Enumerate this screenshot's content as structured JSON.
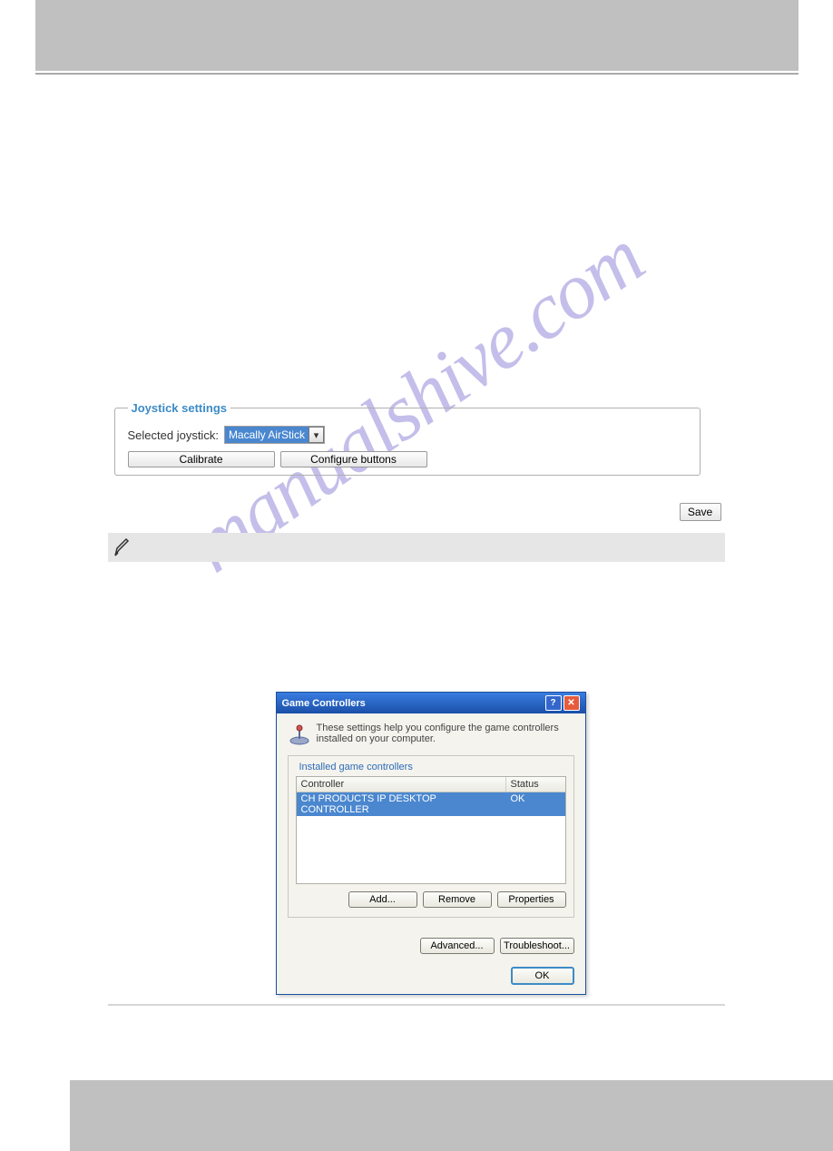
{
  "joystick_settings": {
    "legend": "Joystick settings",
    "selected_label": "Selected joystick:",
    "selected_value": "Macally AirStick",
    "calibrate": "Calibrate",
    "configure": "Configure buttons",
    "save": "Save"
  },
  "game_controllers": {
    "title": "Game Controllers",
    "description": "These settings help you configure the game controllers installed on your computer.",
    "group_title": "Installed game controllers",
    "columns": {
      "controller": "Controller",
      "status": "Status"
    },
    "row": {
      "name": "CH PRODUCTS IP DESKTOP CONTROLLER",
      "status": "OK"
    },
    "buttons": {
      "add": "Add...",
      "remove": "Remove",
      "properties": "Properties",
      "advanced": "Advanced...",
      "troubleshoot": "Troubleshoot...",
      "ok": "OK"
    },
    "help_glyph": "?",
    "close_glyph": "✕"
  },
  "watermark": "manualshive.com"
}
